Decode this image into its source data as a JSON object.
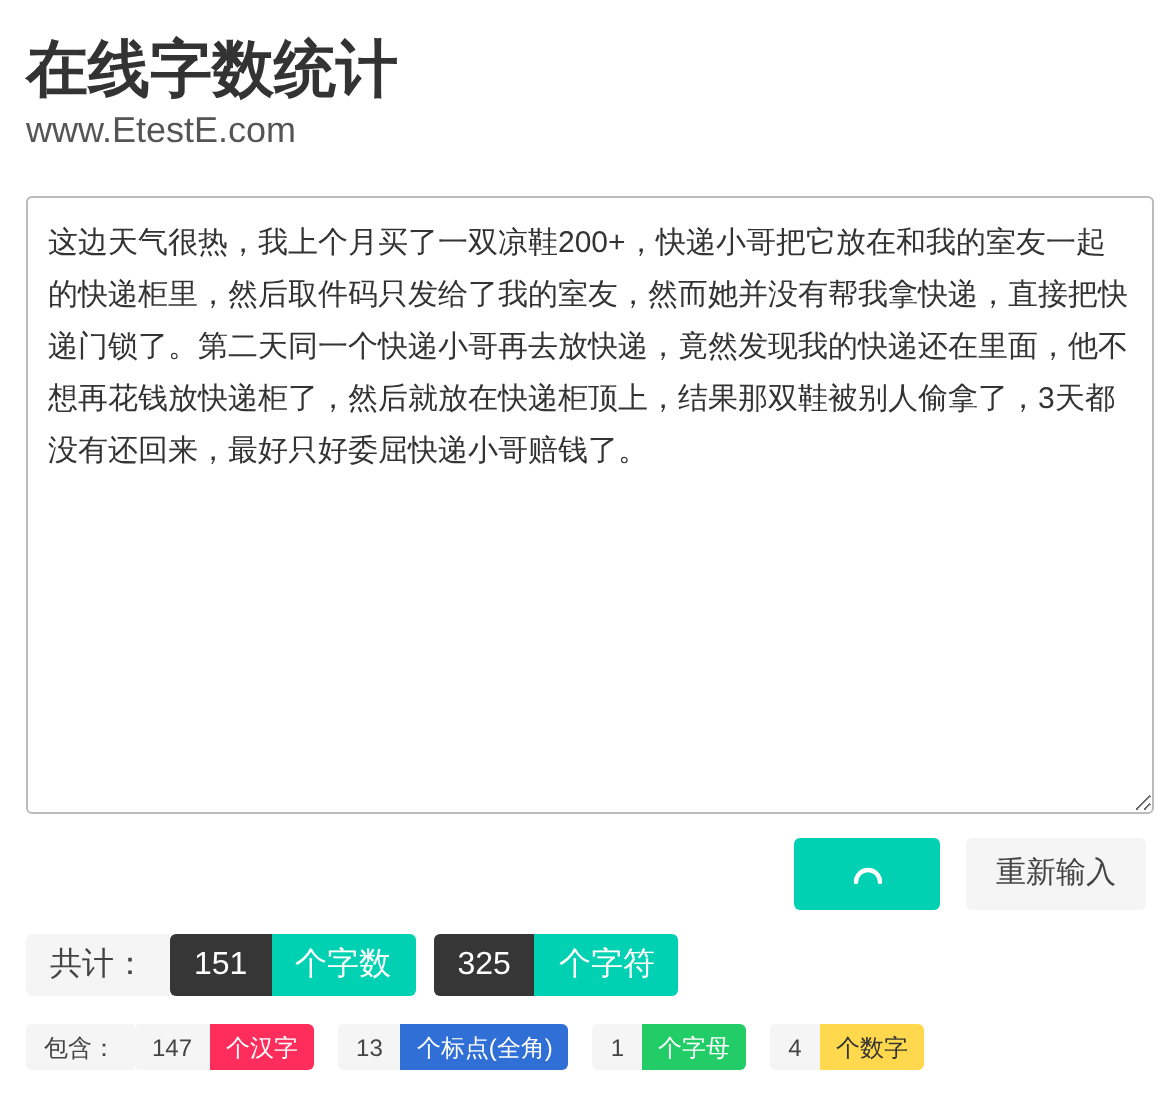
{
  "title": "在线字数统计",
  "subtitle": "www.EtestE.com",
  "input": {
    "value": "这边天气很热，我上个月买了一双凉鞋200+，快递小哥把它放在和我的室友一起的快递柜里，然后取件码只发给了我的室友，然而她并没有帮我拿快递，直接把快递门锁了。第二天同一个快递小哥再去放快递，竟然发现我的快递还在里面，他不想再花钱放快递柜了，然后就放在快递柜顶上，结果那双鞋被别人偷拿了，3天都没有还回来，最好只好委屈快递小哥赔钱了。"
  },
  "buttons": [
    {
      "kind": "loading"
    },
    {
      "kind": "text",
      "label": "重新输入"
    }
  ],
  "totals": {
    "label": "共计：",
    "items": [
      {
        "count": "151",
        "unit": "个字数"
      },
      {
        "count": "325",
        "unit": "个字符"
      }
    ]
  },
  "breakdown": {
    "label": "包含：",
    "items": [
      {
        "count": "147",
        "unit": "个汉字",
        "color": "#ff2d5c"
      },
      {
        "count": "13",
        "unit": "个标点(全角)",
        "color": "#2f6fd6"
      },
      {
        "count": "1",
        "unit": "个字母",
        "color": "#22cc66"
      },
      {
        "count": "4",
        "unit": "个数字",
        "color": "#ffd84d"
      }
    ]
  }
}
